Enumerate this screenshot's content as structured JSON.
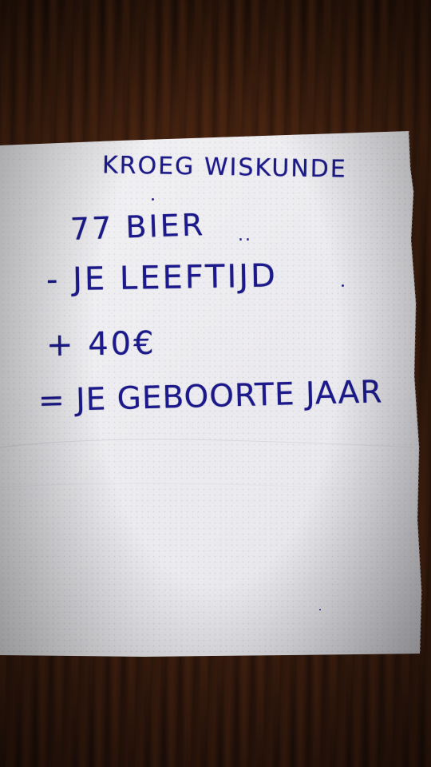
{
  "napkin": {
    "title": "KROEG WISKUNDE",
    "lines": [
      "77 BIER",
      "- JE LEEFTIJD",
      "+ 40€",
      "= JE GEBOORTE JAAR"
    ],
    "mark": ".."
  },
  "colors": {
    "ink": "#1c1a8a",
    "napkin": "#ecebef",
    "table": "#3a1d0e"
  }
}
